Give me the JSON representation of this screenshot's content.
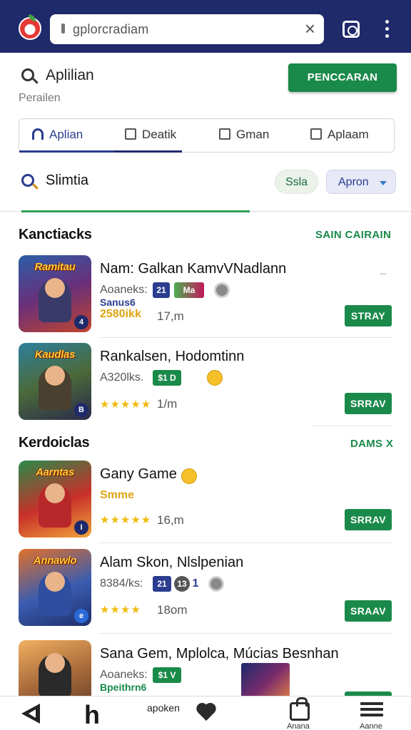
{
  "browser": {
    "url": "gplorcradiam"
  },
  "search": {
    "title": "Aplilian",
    "subtitle": "Perailen",
    "button_label": "PENCCARAN"
  },
  "category_tabs": [
    {
      "label": "Aplian"
    },
    {
      "label": "Deatik"
    },
    {
      "label": "Gman"
    },
    {
      "label": "Aplaam"
    }
  ],
  "filter": {
    "title": "Slimtia",
    "chip_a": "Ssla",
    "chip_b": "Apron"
  },
  "sections": [
    {
      "title": "Kanctiacks",
      "link": "SAIN CAIRAIN",
      "items": [
        {
          "thumb_caption": "Ramitau",
          "badge": "4",
          "title": "Nam: Galkan KamvVNadlann",
          "meta": "Aoaneks:",
          "tags": [
            "21",
            "Ma"
          ],
          "subline": "Sanus6",
          "price": "2580ikk",
          "size": "17,m",
          "get_label": "STRAY",
          "more": "..."
        },
        {
          "thumb_caption": "Kaudlas",
          "badge": "B",
          "title": "Rankalsen, Hodomtinn",
          "meta": "A320lks.",
          "tags": [
            "$1 D"
          ],
          "stars": "★★★★★",
          "size": "1/m",
          "get_label": "SRRAV"
        }
      ]
    },
    {
      "title": "Kerdoiclas",
      "link": "DAMS X",
      "items": [
        {
          "thumb_caption": "Aarntas",
          "badge": "I",
          "title": "Gany Game",
          "subline": "Smme",
          "stars": "★★★★★",
          "size": "16,m",
          "get_label": "SRRAV"
        },
        {
          "thumb_caption": "Annawlo",
          "badge": "e",
          "title": "Alam Skon, Nlslpenian",
          "meta": "8384/ks:",
          "tags": [
            "21",
            "13",
            "1"
          ],
          "stars": "★★★★",
          "size": "18om",
          "get_label": "SRAAV"
        },
        {
          "title": "Sana Gem, Mplolca, Múcias Besnhan",
          "meta": "Aoaneks:",
          "tags": [
            "$1 V"
          ],
          "subline": "Bpeithrn6"
        }
      ]
    }
  ],
  "bottom_nav": {
    "middle_label": "apoken",
    "bag_label": "Anana",
    "list_label": "Aanne"
  },
  "colors": {
    "topbar": "#1f2a6b",
    "accent_green": "#1a8a4a",
    "accent_blue": "#2a3d8f",
    "price_gold": "#e0a414"
  }
}
